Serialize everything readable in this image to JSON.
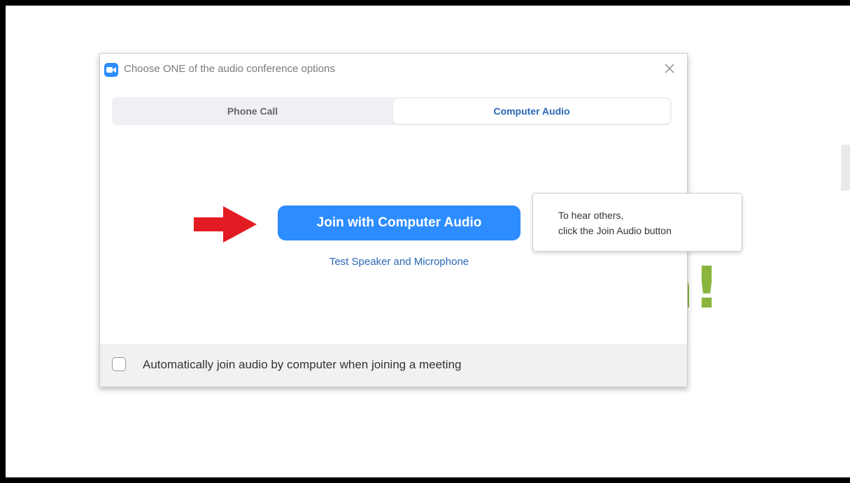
{
  "background": {
    "faint_glyph": "I",
    "green_glyph": "n!",
    "green_color": "#8bb63e"
  },
  "dialog": {
    "title": "Choose ONE of the audio conference options",
    "app_icon": "zoom-camera-icon",
    "close_icon": "close-icon",
    "tabs": [
      {
        "label": "Phone Call",
        "selected": false
      },
      {
        "label": "Computer Audio",
        "selected": true
      }
    ],
    "join_button_label": "Join with Computer Audio",
    "test_link_label": "Test Speaker and Microphone",
    "footer": {
      "checkbox_checked": false,
      "checkbox_label": "Automatically join audio by computer when joining a meeting"
    }
  },
  "annotation": {
    "arrow_icon": "red-arrow-icon",
    "arrow_color": "#e31b23",
    "tooltip_lines": [
      "To hear others,",
      "click the Join Audio button"
    ]
  },
  "colors": {
    "accent": "#2d8cff",
    "link": "#2a66b6"
  }
}
